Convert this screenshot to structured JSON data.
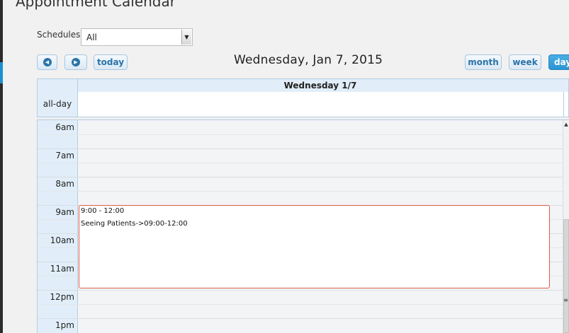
{
  "page": {
    "title": "Appointment Calendar"
  },
  "schedules": {
    "label": "Schedules:",
    "selected": "All"
  },
  "toolbar": {
    "prev_icon": "prev-arrow-icon",
    "next_icon": "next-arrow-icon",
    "today_label": "today",
    "date_title": "Wednesday, Jan 7, 2015",
    "views": [
      "month",
      "week",
      "day"
    ],
    "active_view": "day"
  },
  "calendar": {
    "column_header": "Wednesday 1/7",
    "allday_label": "all-day",
    "hours": [
      "6am",
      "7am",
      "8am",
      "9am",
      "10am",
      "11am",
      "12pm",
      "1pm"
    ],
    "events": [
      {
        "time": "9:00 - 12:00",
        "title": "Seeing Patients->09:00-12:00",
        "border_color": "#e05b48"
      }
    ]
  },
  "colors": {
    "accent": "#2b95d3",
    "header_bg": "#e1eef9",
    "grid_border": "#b3cde3"
  }
}
